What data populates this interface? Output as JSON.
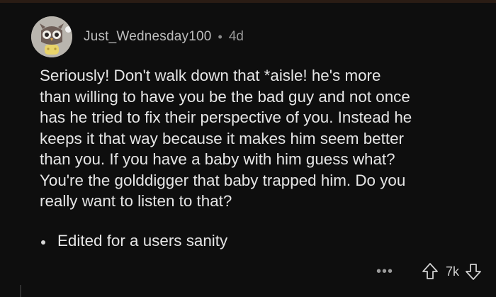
{
  "comment": {
    "username": "Just_Wednesday100",
    "separator": "•",
    "age": "4d",
    "body": "Seriously! Don't walk down that *aisle! he's more\nthan willing to have you be the bad guy and not once\nhas he tried to fix their perspective of you. Instead he\nkeeps it that way because it makes him seem better\nthan you. If you have a baby with him guess what?\nYou're the golddigger that baby trapped him. Do you\nreally want to listen to that?",
    "bullet_items": [
      "Edited for a users sanity"
    ]
  },
  "actions": {
    "more_label": "•••",
    "vote_count": "7k",
    "icons": {
      "more": "more-options-icon",
      "upvote": "upvote-arrow-icon",
      "downvote": "downvote-arrow-icon"
    }
  },
  "colors": {
    "background": "#0e0e0e",
    "text": "#e6e6e6",
    "muted": "#9a9a9a"
  }
}
